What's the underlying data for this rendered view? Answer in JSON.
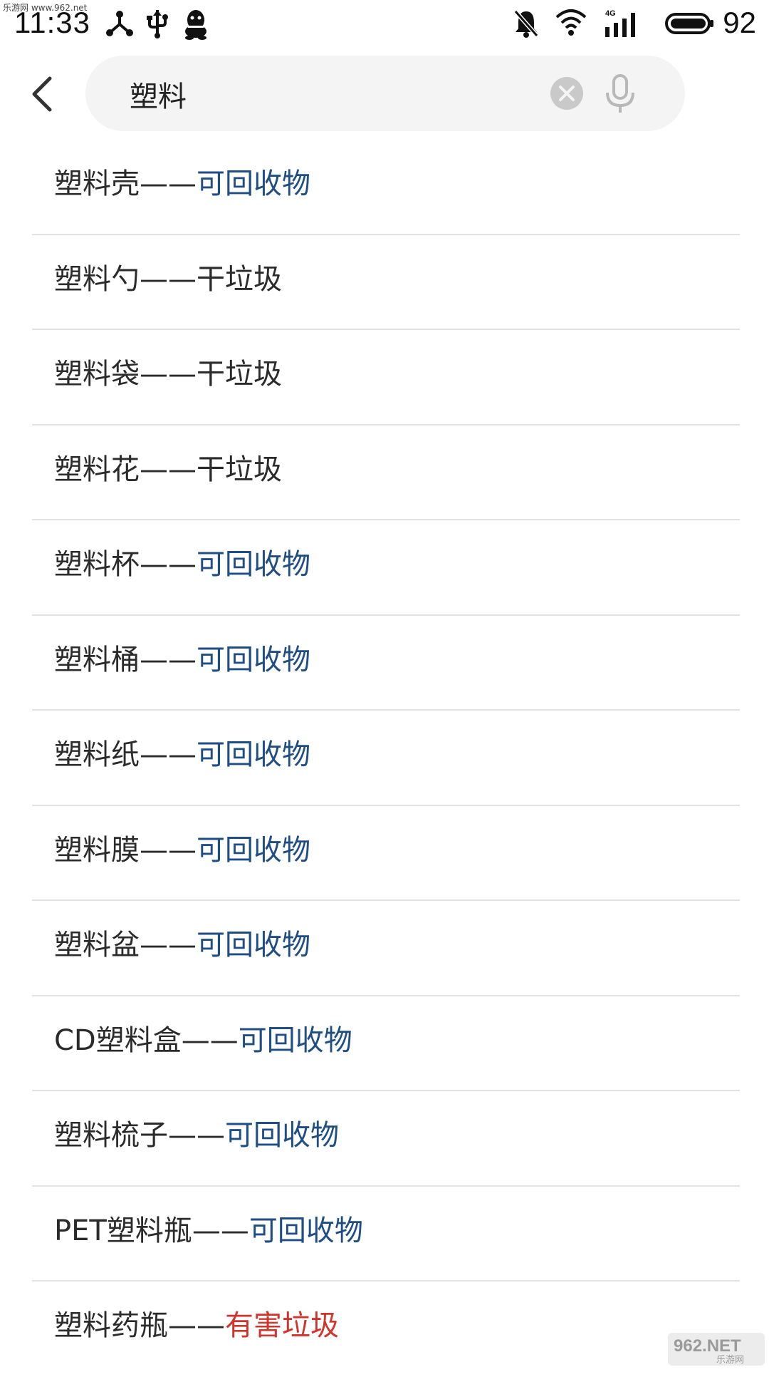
{
  "watermark_top": "乐游网 www.962.net",
  "status_bar": {
    "time": "11:33",
    "network_label": "4G",
    "battery_level": "92"
  },
  "search": {
    "query": "塑料",
    "placeholder": ""
  },
  "separator": "——",
  "results": [
    {
      "name": "塑料壳",
      "category": "可回收物",
      "category_type": "recyclable"
    },
    {
      "name": "塑料勺",
      "category": "干垃圾",
      "category_type": "dry"
    },
    {
      "name": "塑料袋",
      "category": "干垃圾",
      "category_type": "dry"
    },
    {
      "name": "塑料花",
      "category": "干垃圾",
      "category_type": "dry"
    },
    {
      "name": "塑料杯",
      "category": "可回收物",
      "category_type": "recyclable"
    },
    {
      "name": "塑料桶",
      "category": "可回收物",
      "category_type": "recyclable"
    },
    {
      "name": "塑料纸",
      "category": "可回收物",
      "category_type": "recyclable"
    },
    {
      "name": "塑料膜",
      "category": "可回收物",
      "category_type": "recyclable"
    },
    {
      "name": "塑料盆",
      "category": "可回收物",
      "category_type": "recyclable"
    },
    {
      "name": "CD塑料盒",
      "category": "可回收物",
      "category_type": "recyclable"
    },
    {
      "name": "塑料梳子",
      "category": "可回收物",
      "category_type": "recyclable"
    },
    {
      "name": "PET塑料瓶",
      "category": "可回收物",
      "category_type": "recyclable"
    },
    {
      "name": "塑料药瓶",
      "category": "有害垃圾",
      "category_type": "hazardous"
    }
  ],
  "colors": {
    "recyclable": "#1f4e86",
    "dry": "#2b2b2b",
    "hazardous": "#d0342c"
  },
  "watermark_logo": {
    "brand": "962.NET",
    "subtitle": "乐游网"
  }
}
